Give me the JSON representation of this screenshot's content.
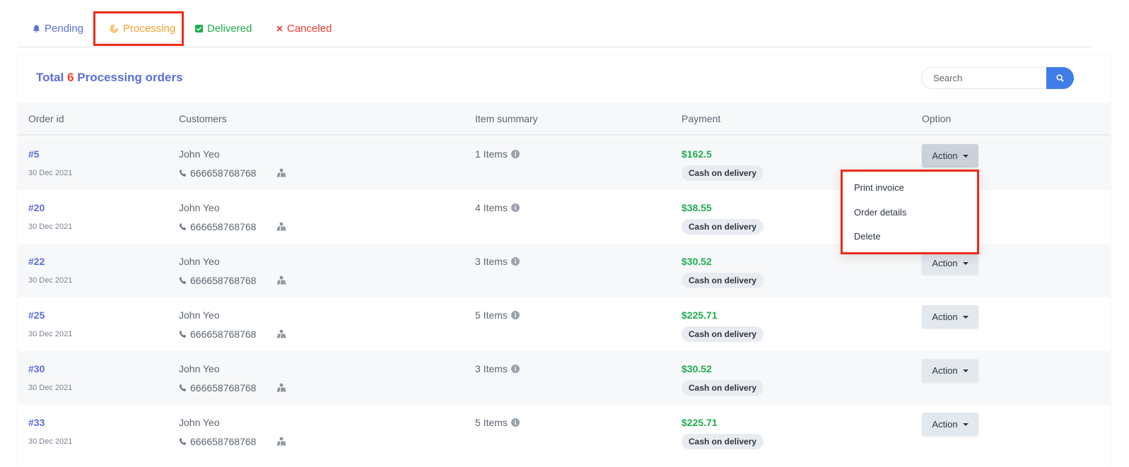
{
  "tabs": [
    {
      "label": "Pending",
      "icon": "bell-icon",
      "color": "#5b6ed8"
    },
    {
      "label": "Processing",
      "icon": "spinner-icon",
      "color": "#f4a12c"
    },
    {
      "label": "Delivered",
      "icon": "check-square-icon",
      "color": "#1fad4f"
    },
    {
      "label": "Canceled",
      "icon": "x-icon",
      "color": "#ef3a2e"
    }
  ],
  "summary": {
    "prefix": "Total",
    "count": "6",
    "suffix": "Processing orders"
  },
  "search": {
    "placeholder": "Search"
  },
  "table": {
    "headers": [
      "Order id",
      "Customers",
      "Item summary",
      "Payment",
      "Option"
    ],
    "rows": [
      {
        "id": "#5",
        "date": "30 Dec 2021",
        "customer": "John Yeo",
        "phone": "666658768768",
        "items": "1 Items",
        "amount": "$162.5",
        "method": "Cash on delivery",
        "action": "Action"
      },
      {
        "id": "#20",
        "date": "30 Dec 2021",
        "customer": "John Yeo",
        "phone": "666658768768",
        "items": "4 Items",
        "amount": "$38.55",
        "method": "Cash on delivery",
        "action": "Action"
      },
      {
        "id": "#22",
        "date": "30 Dec 2021",
        "customer": "John Yeo",
        "phone": "666658768768",
        "items": "3 Items",
        "amount": "$30.52",
        "method": "Cash on delivery",
        "action": "Action"
      },
      {
        "id": "#25",
        "date": "30 Dec 2021",
        "customer": "John Yeo",
        "phone": "666658768768",
        "items": "5 Items",
        "amount": "$225.71",
        "method": "Cash on delivery",
        "action": "Action"
      },
      {
        "id": "#30",
        "date": "30 Dec 2021",
        "customer": "John Yeo",
        "phone": "666658768768",
        "items": "3 Items",
        "amount": "$30.52",
        "method": "Cash on delivery",
        "action": "Action"
      },
      {
        "id": "#33",
        "date": "30 Dec 2021",
        "customer": "John Yeo",
        "phone": "666658768768",
        "items": "5 Items",
        "amount": "$225.71",
        "method": "Cash on delivery",
        "action": "Action"
      }
    ]
  },
  "dropdown": {
    "items": [
      "Print invoice",
      "Order details",
      "Delete"
    ]
  },
  "colors": {
    "accent": "#5b6ed8",
    "success": "#1fad4f",
    "danger": "#ef3a2e",
    "warning": "#f4a12c",
    "search_button": "#3f7de8",
    "highlight_box": "#ef2a1a"
  }
}
